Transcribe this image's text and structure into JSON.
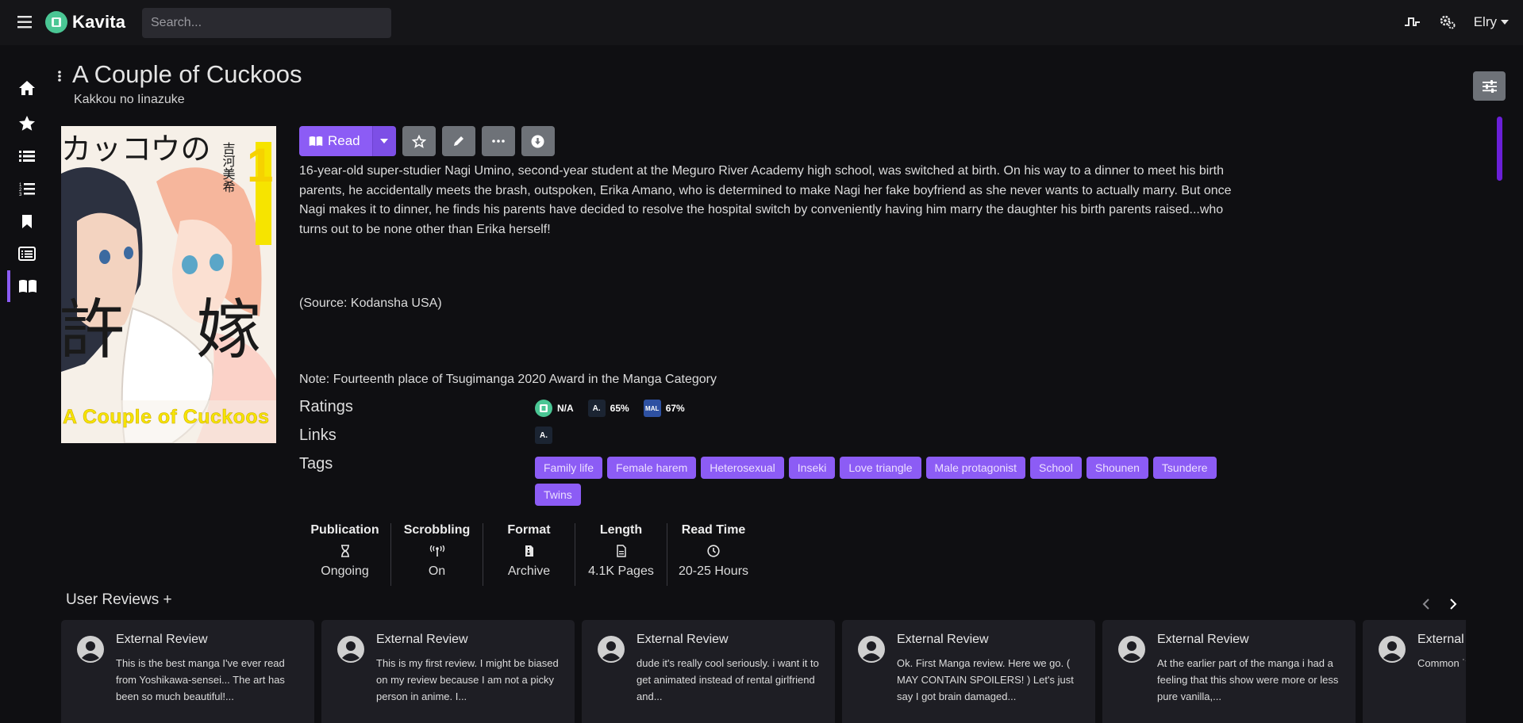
{
  "app": {
    "name": "Kavita",
    "search_placeholder": "Search...",
    "user_name": "Elry"
  },
  "sidebar": {
    "items": [
      {
        "name": "home",
        "icon": "home-icon"
      },
      {
        "name": "want-to-read",
        "icon": "star-icon"
      },
      {
        "name": "collections",
        "icon": "list-icon"
      },
      {
        "name": "reading-lists",
        "icon": "ordered-list-icon"
      },
      {
        "name": "bookmarks",
        "icon": "bookmark-icon"
      },
      {
        "name": "all-series",
        "icon": "list-alt-icon"
      },
      {
        "name": "library",
        "icon": "book-open-icon",
        "active": true
      }
    ]
  },
  "series": {
    "title": "A Couple of Cuckoos",
    "localized_title": "Kakkou no Iinazuke",
    "summary": "16-year-old super-studier Nagi Umino, second-year student at the Meguro River Academy high school, was switched at birth. On his way to a dinner to meet his birth parents, he accidentally meets the brash, outspoken, Erika Amano, who is determined to make Nagi her fake boyfriend as she never wants to actually marry. But once Nagi makes it to dinner, he finds his parents have decided to resolve the hospital switch by conveniently having him marry the daughter his birth parents raised...who turns out to be none other than Erika herself!",
    "source": "(Source: Kodansha USA)",
    "note": "Note: Fourteenth place of Tsugimanga 2020 Award in the Manga Category",
    "cover_text": {
      "jp_title": "カッコウの",
      "jp_kanji": "許嫁",
      "volume": "1",
      "author": "吉河美希",
      "en_title": "A Couple of Cuckoos"
    }
  },
  "actions": {
    "read_label": "Read"
  },
  "labels": {
    "ratings": "Ratings",
    "links": "Links",
    "tags": "Tags"
  },
  "ratings": [
    {
      "provider": "kavita",
      "value": "N/A",
      "color": "#4ac694",
      "icon": "kavita-icon"
    },
    {
      "provider": "anilist",
      "value": "65%",
      "color": "#1b2432",
      "icon_text": "A."
    },
    {
      "provider": "mal",
      "value": "67%",
      "color": "#2e51a2",
      "icon_text": "MAL"
    }
  ],
  "links": [
    {
      "provider": "anilist",
      "icon_text": "A."
    }
  ],
  "tags": [
    "Family life",
    "Female harem",
    "Heterosexual",
    "Inseki",
    "Love triangle",
    "Male protagonist",
    "School",
    "Shounen",
    "Tsundere",
    "Twins"
  ],
  "stats": [
    {
      "header": "Publication",
      "icon": "hourglass-icon",
      "value": "Ongoing"
    },
    {
      "header": "Scrobbling",
      "icon": "broadcast-icon",
      "value": "On"
    },
    {
      "header": "Format",
      "icon": "file-archive-icon",
      "value": "Archive"
    },
    {
      "header": "Length",
      "icon": "file-lines-icon",
      "value": "4.1K Pages"
    },
    {
      "header": "Read Time",
      "icon": "clock-icon",
      "value": "20-25 Hours"
    }
  ],
  "reviews": {
    "header": "User Reviews",
    "add_symbol": "+",
    "items": [
      {
        "title": "External Review",
        "body": "This is the best manga I've ever read from Yoshikawa-sensei... The art has been so much beautiful!..."
      },
      {
        "title": "External Review",
        "body": "This is my first review. I might be biased on my review because I am not a picky person in anime. I..."
      },
      {
        "title": "External Review",
        "body": "dude it's really cool seriously. i want it to get animated instead of rental girlfriend and..."
      },
      {
        "title": "External Review",
        "body": "Ok. First Manga review. Here we go. ( MAY CONTAIN SPOILERS! ) Let's just say I got brain damaged..."
      },
      {
        "title": "External Review",
        "body": "At the earlier part of the manga i had a feeling that this show were more or less pure vanilla,..."
      },
      {
        "title": "External Review",
        "body": "Common ˙ˆ˚•͡•˚ˆ˙. . . follow Nagi"
      }
    ]
  },
  "colors": {
    "accent": "#8c5cf5",
    "brand": "#4ac694",
    "background": "#0f0f12",
    "navbar": "#151518",
    "card": "#1e1e24",
    "button_secondary": "#6e7278"
  }
}
